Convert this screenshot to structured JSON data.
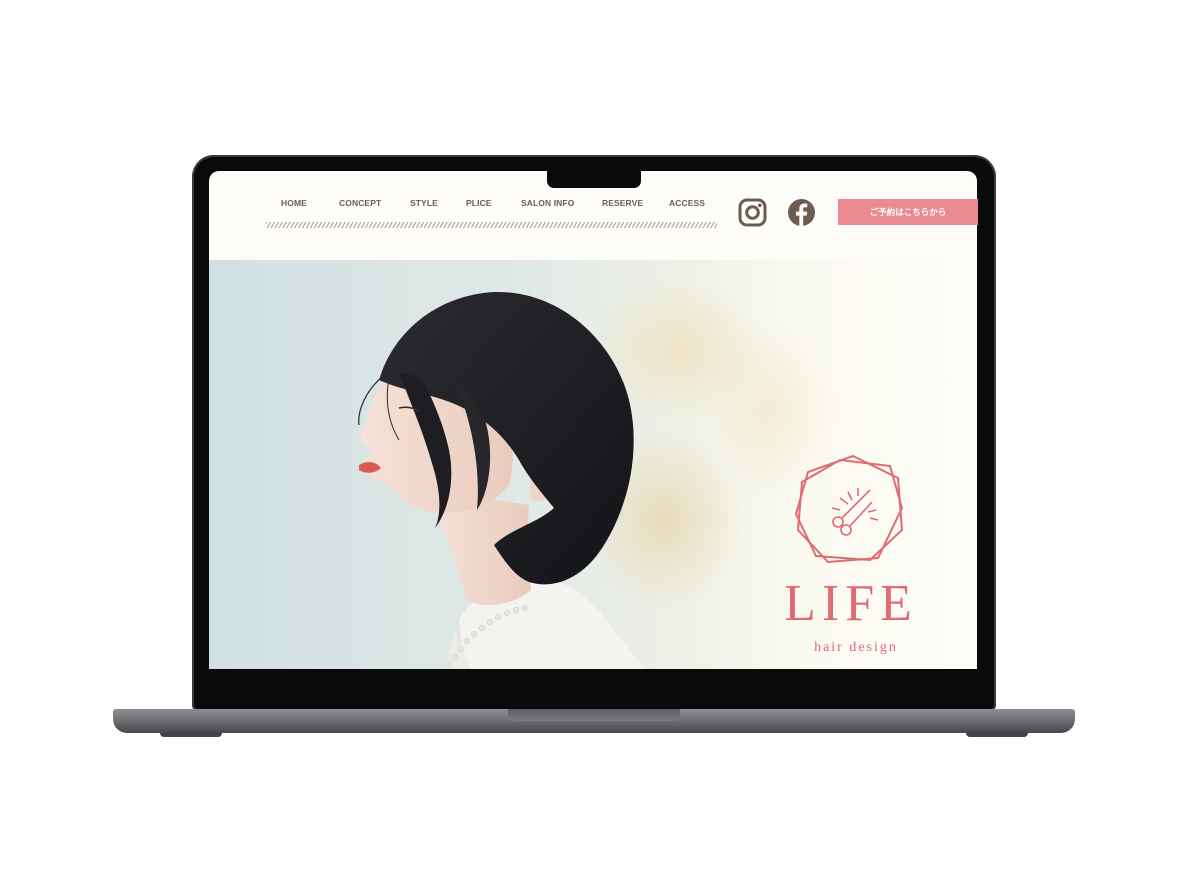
{
  "nav": {
    "items": [
      {
        "label": "HOME"
      },
      {
        "label": "CONCEPT"
      },
      {
        "label": "STYLE"
      },
      {
        "label": "PLICE"
      },
      {
        "label": "SALON INFO"
      },
      {
        "label": "RESERVE"
      },
      {
        "label": "ACCESS"
      }
    ]
  },
  "social": {
    "instagram_icon": "instagram-icon",
    "facebook_icon": "facebook-icon"
  },
  "cta": {
    "label": "ご予約はこちらから"
  },
  "logo": {
    "title": "LIFE",
    "subtitle": "hair design",
    "emblem_icon": "scissors-icon"
  },
  "colors": {
    "accent": "#eb8b91",
    "logo": "#e06b72",
    "nav_text": "#6b5d52",
    "background": "#fdfcf8"
  }
}
